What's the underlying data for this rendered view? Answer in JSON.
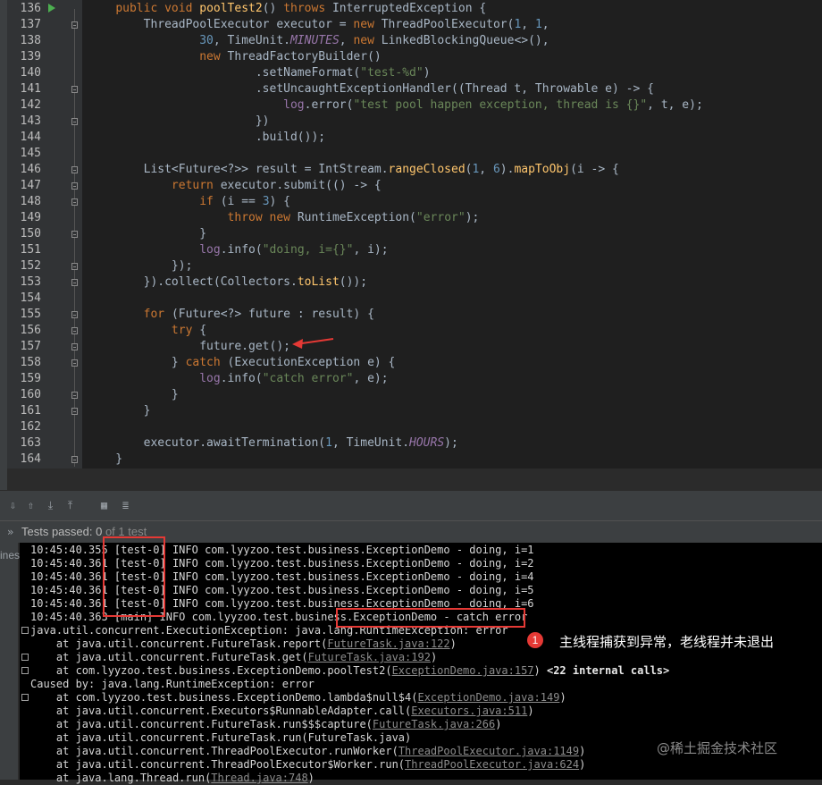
{
  "editor": {
    "line_numbers": [
      "136",
      "137",
      "138",
      "139",
      "140",
      "141",
      "142",
      "143",
      "144",
      "145",
      "146",
      "147",
      "148",
      "149",
      "150",
      "151",
      "152",
      "153",
      "154",
      "155",
      "156",
      "157",
      "158",
      "159",
      "160",
      "161",
      "162",
      "163",
      "164"
    ],
    "lines": [
      [
        [
          "    ",
          ""
        ],
        [
          "public ",
          "kw"
        ],
        [
          "void ",
          "kw"
        ],
        [
          "poolTest2",
          "fn"
        ],
        [
          "() ",
          ""
        ],
        [
          "throws ",
          "kw"
        ],
        [
          "InterruptedException {",
          ""
        ]
      ],
      [
        [
          "        ThreadPoolExecutor executor = ",
          ""
        ],
        [
          "new ",
          "kw"
        ],
        [
          "ThreadPoolExecutor(",
          ""
        ],
        [
          "1",
          "num"
        ],
        [
          ", ",
          ""
        ],
        [
          "1",
          "num"
        ],
        [
          ",",
          ""
        ]
      ],
      [
        [
          "                ",
          ""
        ],
        [
          "30",
          "num"
        ],
        [
          ", TimeUnit.",
          ""
        ],
        [
          "MINUTES",
          "const"
        ],
        [
          ", ",
          ""
        ],
        [
          "new ",
          "kw"
        ],
        [
          "LinkedBlockingQueue<>(),",
          ""
        ]
      ],
      [
        [
          "                ",
          ""
        ],
        [
          "new ",
          "kw"
        ],
        [
          "ThreadFactoryBuilder()",
          ""
        ]
      ],
      [
        [
          "                        .setNameFormat(",
          ""
        ],
        [
          "\"test-%d\"",
          "str"
        ],
        [
          ")",
          ""
        ]
      ],
      [
        [
          "                        .setUncaughtExceptionHandler((Thread t, Throwable e) -> {",
          ""
        ]
      ],
      [
        [
          "                            ",
          ""
        ],
        [
          "log",
          "field"
        ],
        [
          ".error(",
          ""
        ],
        [
          "\"test pool happen exception, thread is {}\"",
          "str"
        ],
        [
          ", t, e);",
          ""
        ]
      ],
      [
        [
          "                        })",
          ""
        ]
      ],
      [
        [
          "                        .build());",
          ""
        ]
      ],
      [
        [
          "",
          ""
        ]
      ],
      [
        [
          "        List<Future<?>> result = IntStream.",
          ""
        ],
        [
          "rangeClosed",
          "fn"
        ],
        [
          "(",
          ""
        ],
        [
          "1",
          "num"
        ],
        [
          ", ",
          ""
        ],
        [
          "6",
          "num"
        ],
        [
          ").",
          ""
        ],
        [
          "mapToObj",
          "fn"
        ],
        [
          "(i -> {",
          ""
        ]
      ],
      [
        [
          "            ",
          ""
        ],
        [
          "return ",
          "kw"
        ],
        [
          "executor.submit(() -> {",
          ""
        ]
      ],
      [
        [
          "                ",
          ""
        ],
        [
          "if ",
          "kw"
        ],
        [
          "(i == ",
          ""
        ],
        [
          "3",
          "num"
        ],
        [
          ") {",
          ""
        ]
      ],
      [
        [
          "                    ",
          ""
        ],
        [
          "throw ",
          "kw"
        ],
        [
          "new ",
          "kw"
        ],
        [
          "RuntimeException(",
          ""
        ],
        [
          "\"error\"",
          "str"
        ],
        [
          ");",
          ""
        ]
      ],
      [
        [
          "                }",
          ""
        ]
      ],
      [
        [
          "                ",
          ""
        ],
        [
          "log",
          "field"
        ],
        [
          ".info(",
          ""
        ],
        [
          "\"doing, i={}\"",
          "str"
        ],
        [
          ", i);",
          ""
        ]
      ],
      [
        [
          "            });",
          ""
        ]
      ],
      [
        [
          "        }).collect(Collectors.",
          ""
        ],
        [
          "toList",
          "fn"
        ],
        [
          "());",
          ""
        ]
      ],
      [
        [
          "",
          ""
        ]
      ],
      [
        [
          "        ",
          ""
        ],
        [
          "for ",
          "kw"
        ],
        [
          "(Future<?> future : result) {",
          ""
        ]
      ],
      [
        [
          "            ",
          ""
        ],
        [
          "try ",
          "kw"
        ],
        [
          "{",
          ""
        ]
      ],
      [
        [
          "                future.get();",
          ""
        ]
      ],
      [
        [
          "            } ",
          ""
        ],
        [
          "catch ",
          "kw"
        ],
        [
          "(ExecutionException e) {",
          ""
        ]
      ],
      [
        [
          "                ",
          ""
        ],
        [
          "log",
          "field"
        ],
        [
          ".info(",
          ""
        ],
        [
          "\"catch error\"",
          "str"
        ],
        [
          ", e);",
          ""
        ]
      ],
      [
        [
          "            }",
          ""
        ]
      ],
      [
        [
          "        }",
          ""
        ]
      ],
      [
        [
          "",
          ""
        ]
      ],
      [
        [
          "        executor.awaitTermination(",
          ""
        ],
        [
          "1",
          "num"
        ],
        [
          ", TimeUnit.",
          ""
        ],
        [
          "HOURS",
          "const"
        ],
        [
          ");",
          ""
        ]
      ],
      [
        [
          "    }",
          ""
        ]
      ]
    ]
  },
  "toolbar": {
    "icons": [
      "sort-down-icon",
      "sort-up-icon",
      "import-icon",
      "export-icon",
      "table-icon",
      "settings-list-icon"
    ]
  },
  "status": {
    "chevron": "»",
    "text": "Tests passed: 0",
    "extra": " of 1 test"
  },
  "sidepanel": {
    "label": "ines"
  },
  "console": {
    "lines": [
      {
        "prefix": "",
        "text": "10:45:40.355 [test-0] INFO com.lyyzoo.test.business.ExceptionDemo - doing, i=1"
      },
      {
        "prefix": "",
        "text": "10:45:40.361 [test-0] INFO com.lyyzoo.test.business.ExceptionDemo - doing, i=2"
      },
      {
        "prefix": "",
        "text": "10:45:40.361 [test-0] INFO com.lyyzoo.test.business.ExceptionDemo - doing, i=4"
      },
      {
        "prefix": "",
        "text": "10:45:40.361 [test-0] INFO com.lyyzoo.test.business.ExceptionDemo - doing, i=5"
      },
      {
        "prefix": "",
        "text": "10:45:40.361 [test-0] INFO com.lyyzoo.test.business.ExceptionDemo - doing, i=6"
      },
      {
        "prefix": "",
        "text": "10:45:40.363 [main] INFO com.lyyzoo.test.business.ExceptionDemo - catch error"
      },
      {
        "prefix": "",
        "text": "java.util.concurrent.ExecutionException: java.lang.RuntimeException: error"
      },
      {
        "prefix": "    at java.util.concurrent.FutureTask.report(",
        "link": "FutureTask.java:122",
        "suffix": ")"
      },
      {
        "prefix": "    at java.util.concurrent.FutureTask.get(",
        "link": "FutureTask.java:192",
        "suffix": ")"
      },
      {
        "prefix": "    at com.lyyzoo.test.business.ExceptionDemo.poolTest2(",
        "link": "ExceptionDemo.java:157",
        "suffix": ") ",
        "bold": "<22 internal calls>"
      },
      {
        "prefix": "",
        "text": "Caused by: java.lang.RuntimeException: error"
      },
      {
        "prefix": "    at com.lyyzoo.test.business.ExceptionDemo.lambda$null$4(",
        "link": "ExceptionDemo.java:149",
        "suffix": ")"
      },
      {
        "prefix": "    at java.util.concurrent.Executors$RunnableAdapter.call(",
        "link": "Executors.java:511",
        "suffix": ")"
      },
      {
        "prefix": "    at java.util.concurrent.FutureTask.run$$$capture(",
        "link": "FutureTask.java:266",
        "suffix": ")"
      },
      {
        "prefix": "",
        "text": "    at java.util.concurrent.FutureTask.run(FutureTask.java)"
      },
      {
        "prefix": "    at java.util.concurrent.ThreadPoolExecutor.runWorker(",
        "link": "ThreadPoolExecutor.java:1149",
        "suffix": ")"
      },
      {
        "prefix": "    at java.util.concurrent.ThreadPoolExecutor$Worker.run(",
        "link": "ThreadPoolExecutor.java:624",
        "suffix": ")"
      },
      {
        "prefix": "    at java.lang.Thread.run(",
        "link": "Thread.java:748",
        "suffix": ")"
      }
    ]
  },
  "annotation": {
    "badge": "1",
    "text": "主线程捕获到异常，老线程并未退出"
  },
  "watermark": "@稀土掘金技术社区",
  "colors": {
    "highlight_box": "#e53935",
    "keyword": "#cc7832",
    "string": "#6a8759",
    "number": "#6897bb",
    "method": "#ffc66d"
  }
}
